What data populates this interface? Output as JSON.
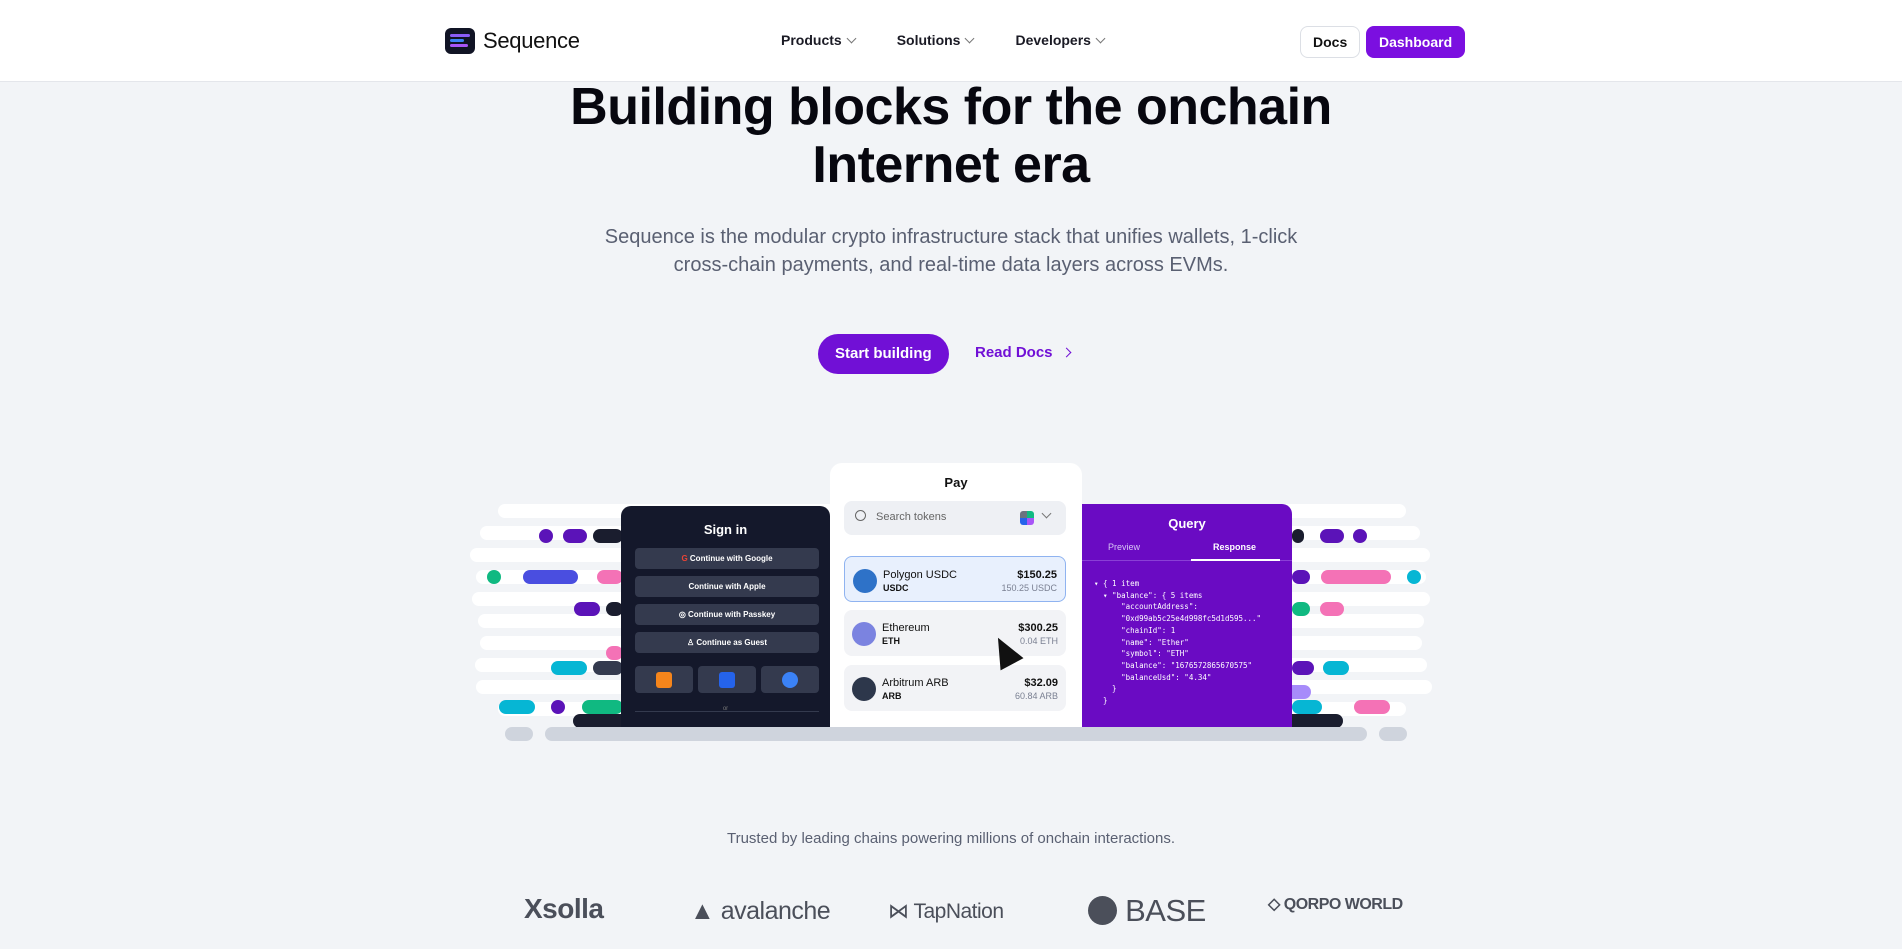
{
  "nav": {
    "brand": "Sequence",
    "links": [
      {
        "label": "Products"
      },
      {
        "label": "Solutions"
      },
      {
        "label": "Developers"
      }
    ],
    "docs_label": "Docs",
    "dashboard_label": "Dashboard",
    "accent": "#7b0fe0"
  },
  "hero": {
    "title_line1": "Building blocks for the onchain",
    "title_line2": "Internet era",
    "subtitle_line1": "Sequence is the modular crypto infrastructure stack that unifies wallets, 1-click",
    "subtitle_line2": "cross-chain payments, and real-time data layers across EVMs.",
    "cta_label": "Start building",
    "secondary_label": "Read Docs"
  },
  "signin": {
    "title": "Sign in",
    "options": [
      "Continue with Google",
      "Continue with Apple",
      "Continue with Passkey",
      "Continue as Guest"
    ],
    "divider": "or"
  },
  "pay": {
    "title": "Pay",
    "search_placeholder": "Search tokens",
    "tokens": [
      {
        "name": "Polygon USDC",
        "symbol": "USDC",
        "value": "$150.25",
        "balance": "150.25 USDC",
        "selected": true
      },
      {
        "name": "Ethereum",
        "symbol": "ETH",
        "value": "$300.25",
        "balance": "0.04 ETH",
        "selected": false
      },
      {
        "name": "Arbitrum ARB",
        "symbol": "ARB",
        "value": "$32.09",
        "balance": "60.84 ARB",
        "selected": false
      }
    ]
  },
  "query": {
    "title": "Query",
    "tabs": [
      "Preview",
      "Response"
    ],
    "active_tab": "Response",
    "code": "▾ { 1 item\n  ▾ \"balance\": { 5 items\n      \"accountAddress\":\n      \"0xd99ab5c25e4d998fc5d1d595...\"\n      \"chainId\": 1\n      \"name\": \"Ether\"\n      \"symbol\": \"ETH\"\n      \"balance\": \"1676572865670575\"\n      \"balanceUsd\": \"4.34\"\n    }\n  }"
  },
  "trust": {
    "text": "Trusted by leading chains powering millions of onchain interactions.",
    "logos": [
      "Xsolla",
      "avalanche",
      "TapNation",
      "BASE",
      "QORPO WORLD"
    ]
  }
}
